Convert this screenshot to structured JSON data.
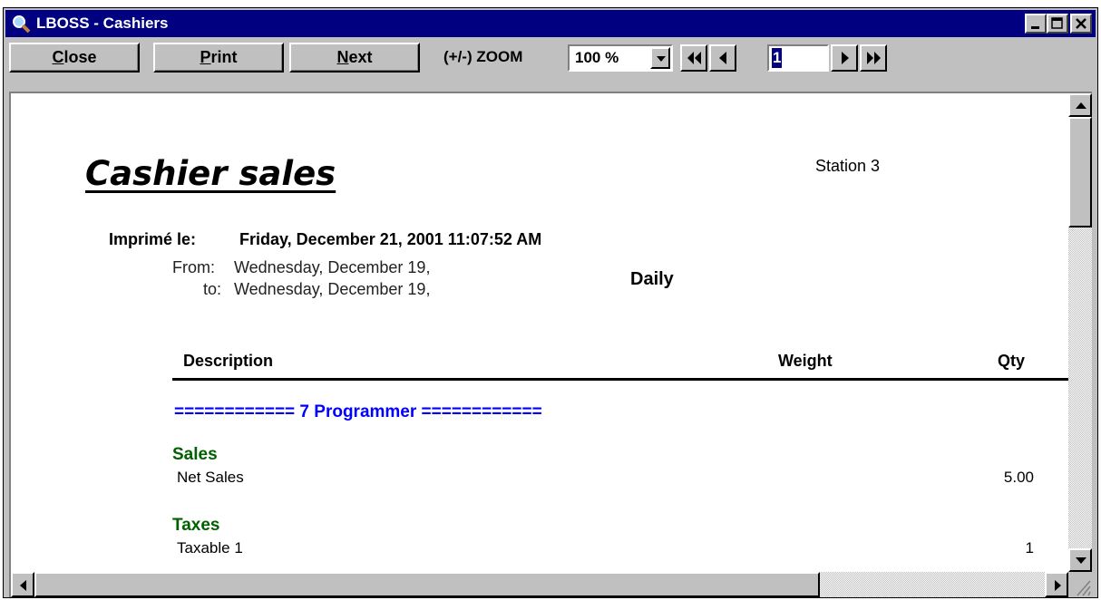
{
  "window": {
    "title": "LBOSS - Cashiers",
    "title_icon": "magnifier-icon",
    "controls": [
      "minimize-icon",
      "maximize-icon",
      "close-icon"
    ]
  },
  "toolbar": {
    "close_mnemonic": "C",
    "close_rest": "lose",
    "print_mnemonic": "P",
    "print_rest": "rint",
    "next_mnemonic": "N",
    "next_rest": "ext",
    "zoom_label": "(+/-)  ZOOM",
    "zoom_value": "100 %",
    "page_number": "1",
    "nav_icons": [
      "first-page-icon",
      "previous-page-icon",
      "next-page-icon",
      "last-page-icon"
    ]
  },
  "report": {
    "title": "Cashier sales",
    "station": "Station 3",
    "printed_label": "Imprimé le:",
    "printed_value": "Friday, December 21, 2001 11:07:52 AM",
    "from_label": "From:",
    "from_value": "Wednesday, December 19,",
    "to_label": "to:",
    "to_value": "Wednesday, December 19,",
    "period": "Daily",
    "columns": {
      "description": "Description",
      "weight": "Weight",
      "qty": "Qty"
    },
    "group_line": "============ 7  Programmer ============",
    "sections": [
      {
        "title": "Sales",
        "rows": [
          {
            "label": "Net Sales",
            "value": "5.00"
          }
        ]
      },
      {
        "title": "Taxes",
        "rows": [
          {
            "label": "Taxable 1",
            "value": "1"
          }
        ]
      }
    ]
  },
  "colors": {
    "title_bar": "#000080",
    "group_line": "#0000ff",
    "section_title": "#006000",
    "face": "#c0c0c0"
  }
}
